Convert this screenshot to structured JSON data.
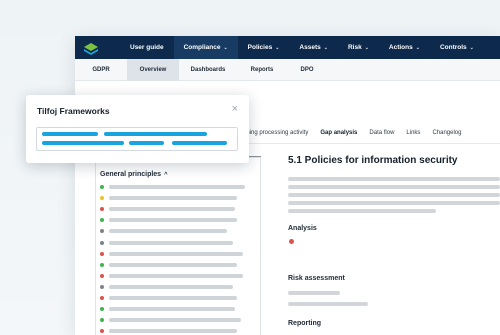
{
  "topbar": {
    "logo_icon": "layers-icon",
    "items": [
      {
        "label": "User guide",
        "chevron": false
      },
      {
        "label": "Compliance",
        "chevron": true,
        "active": true
      },
      {
        "label": "Policies",
        "chevron": true
      },
      {
        "label": "Assets",
        "chevron": true
      },
      {
        "label": "Risk",
        "chevron": true
      },
      {
        "label": "Actions",
        "chevron": true
      },
      {
        "label": "Controls",
        "chevron": true
      }
    ],
    "chevron_glyph": "⌄",
    "background": "#0d2a4c"
  },
  "subnav": {
    "items": [
      "GDPR",
      "Overview",
      "Dashboards",
      "Reports",
      "DPO"
    ],
    "active": "Overview"
  },
  "tabs": {
    "items": [
      "ening processing activity",
      "Gap analysis",
      "Data flow",
      "Links",
      "Changelog"
    ],
    "active": "Gap analysis",
    "accent": "#0aa6c2"
  },
  "left_panel": {
    "title": "General principles",
    "caret": "^",
    "status_colors": {
      "green": "#3fb54f",
      "yellow": "#e8c42a",
      "red": "#d9534f",
      "gray": "#7c848b"
    },
    "rows": [
      "green",
      "yellow",
      "red",
      "green",
      "gray",
      "gray",
      "red",
      "green",
      "red",
      "gray",
      "red",
      "green",
      "green",
      "red",
      "green"
    ]
  },
  "detail": {
    "title": "5.1 Policies for information security",
    "sections": [
      {
        "label": "Analysis",
        "status": "red"
      },
      {
        "label": "Risk assessment"
      },
      {
        "label": "Reporting"
      }
    ]
  },
  "popup": {
    "title": "Tilfoj Frameworks",
    "close_glyph": "×",
    "accent": "#1aa4dd"
  }
}
